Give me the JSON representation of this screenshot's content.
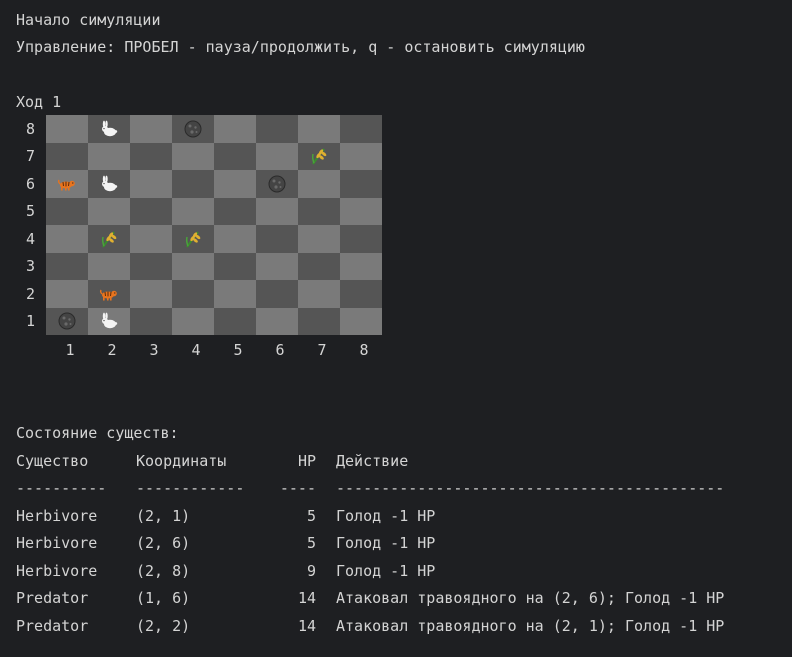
{
  "header": {
    "start_line": "Начало симуляции",
    "controls_line": "Управление: ПРОБЕЛ - пауза/продолжить, q - остановить симуляцию"
  },
  "turn": {
    "label": "Ход 1"
  },
  "board": {
    "row_labels": [
      "8",
      "7",
      "6",
      "5",
      "4",
      "3",
      "2",
      "1"
    ],
    "col_labels": [
      "1",
      "2",
      "3",
      "4",
      "5",
      "6",
      "7",
      "8"
    ],
    "colors": {
      "light": "#7a7a7a",
      "dark": "#555555"
    },
    "entities": [
      {
        "type": "rabbit",
        "icon": "rabbit-icon",
        "x": 2,
        "y": 8
      },
      {
        "type": "rock",
        "icon": "rock-icon",
        "x": 4,
        "y": 8
      },
      {
        "type": "grass",
        "icon": "grass-icon",
        "x": 7,
        "y": 7
      },
      {
        "type": "tiger",
        "icon": "tiger-icon",
        "x": 1,
        "y": 6
      },
      {
        "type": "rabbit",
        "icon": "rabbit-icon",
        "x": 2,
        "y": 6
      },
      {
        "type": "rock",
        "icon": "rock-icon",
        "x": 6,
        "y": 6
      },
      {
        "type": "grass",
        "icon": "grass-icon",
        "x": 2,
        "y": 4
      },
      {
        "type": "grass",
        "icon": "grass-icon",
        "x": 4,
        "y": 4
      },
      {
        "type": "tiger",
        "icon": "tiger-icon",
        "x": 2,
        "y": 2
      },
      {
        "type": "rock",
        "icon": "rock-icon",
        "x": 1,
        "y": 1
      },
      {
        "type": "rabbit",
        "icon": "rabbit-icon",
        "x": 2,
        "y": 1
      }
    ]
  },
  "status": {
    "title": "Состояние существ:",
    "columns": {
      "creature": "Существо",
      "coords": "Координаты",
      "hp": "HP",
      "action": "Действие"
    },
    "separators": {
      "creature": "----------",
      "coords": "------------",
      "hp": "----",
      "action": "-------------------------------------------"
    },
    "rows": [
      {
        "creature": "Herbivore",
        "coords": "(2, 1)",
        "hp": "5",
        "action": "Голод -1 HP"
      },
      {
        "creature": "Herbivore",
        "coords": "(2, 6)",
        "hp": "5",
        "action": "Голод -1 HP"
      },
      {
        "creature": "Herbivore",
        "coords": "(2, 8)",
        "hp": "9",
        "action": "Голод -1 HP"
      },
      {
        "creature": "Predator",
        "coords": "(1, 6)",
        "hp": "14",
        "action": "Атаковал травоядного на (2, 6); Голод -1 HP"
      },
      {
        "creature": "Predator",
        "coords": "(2, 2)",
        "hp": "14",
        "action": "Атаковал травоядного на (2, 1); Голод -1 HP"
      }
    ]
  }
}
